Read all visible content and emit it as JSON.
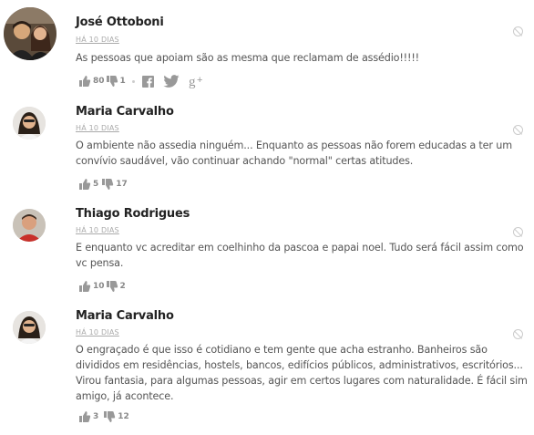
{
  "comments": [
    {
      "author": "José Ottoboni",
      "time": "HÁ 10 DIAS",
      "text": "As pessoas que apoiam são as mesma que reclamam de assédio!!!!!",
      "likes": "80",
      "dislikes": "1"
    },
    {
      "author": "Maria Carvalho",
      "time": "HÁ 10 DIAS",
      "text": "O ambiente não assedia ninguém... Enquanto as pessoas não forem educadas a ter um convívio saudável, vão continuar achando \"normal\" certas atitudes.",
      "likes": "5",
      "dislikes": "17"
    },
    {
      "author": "Thiago Rodrigues",
      "time": "HÁ 10 DIAS",
      "text": "E enquanto vc acreditar em coelhinho da pascoa e papai noel. Tudo será fácil assim como vc pensa.",
      "likes": "10",
      "dislikes": "2"
    },
    {
      "author": "Maria Carvalho",
      "time": "HÁ 10 DIAS",
      "text": "O engraçado é que isso é cotidiano e tem gente que acha estranho. Banheiros são divididos em residências, hostels, bancos, edifícios públicos, administrativos, escritórios... Virou fantasia, para algumas pessoas, agir em certos lugares com naturalidade. É fácil sim amigo, já acontece.",
      "likes": "3",
      "dislikes": "12"
    }
  ],
  "share_icons": [
    "facebook-icon",
    "twitter-icon",
    "google-plus-icon"
  ],
  "colors": {
    "icon_gray": "#999999",
    "text_gray": "#555555"
  }
}
